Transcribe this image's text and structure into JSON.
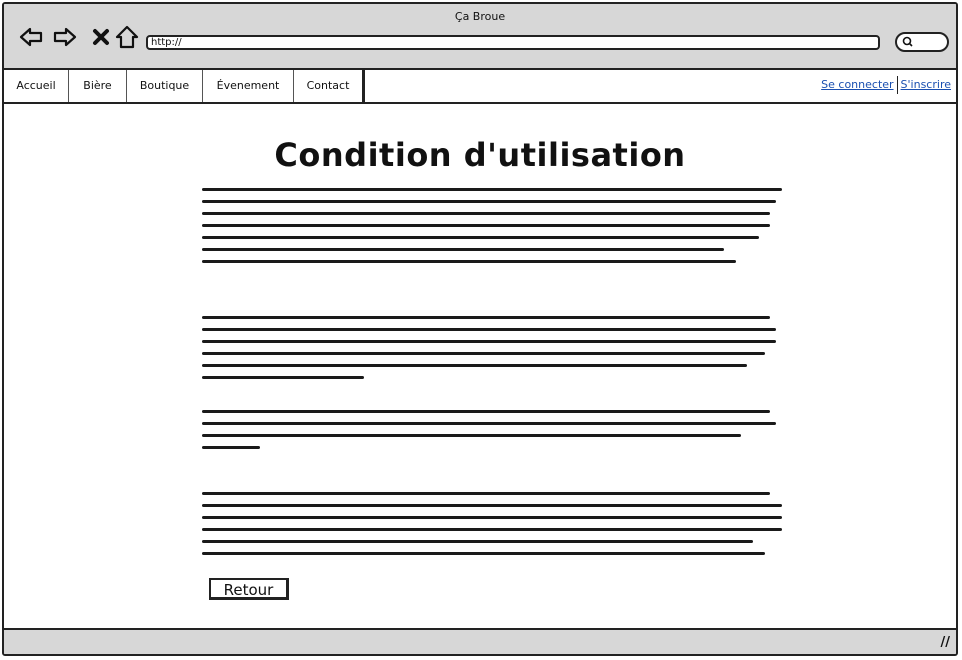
{
  "window": {
    "title": "Ça Broue"
  },
  "toolbar": {
    "back_icon": "back-arrow-icon",
    "forward_icon": "forward-arrow-icon",
    "stop_icon": "close-icon",
    "home_icon": "home-icon",
    "url": "http://"
  },
  "menu": {
    "items": [
      {
        "label": "Accueil"
      },
      {
        "label": "Bière"
      },
      {
        "label": "Boutique"
      },
      {
        "label": "Évenement"
      },
      {
        "label": "Contact"
      }
    ]
  },
  "auth": {
    "login": "Se connecter",
    "signup": "S'inscrire"
  },
  "main": {
    "title": "Condition d'utilisation",
    "paragraphs": [
      {
        "lines": [
          1,
          0.99,
          0.98,
          0.98,
          0.96,
          0.9,
          0.92
        ]
      },
      {
        "lines": [
          0.98,
          0.99,
          0.99,
          0.97,
          0.94,
          0.28
        ]
      },
      {
        "lines": [
          0.98,
          0.99,
          0.93,
          0.1
        ]
      },
      {
        "lines": [
          0.98,
          1,
          1,
          1,
          0.95,
          0.97
        ]
      }
    ],
    "retour_label": "Retour"
  },
  "colors": {
    "chrome": "#d7d7d7",
    "link": "#1a4fb0",
    "ink": "#111111"
  }
}
